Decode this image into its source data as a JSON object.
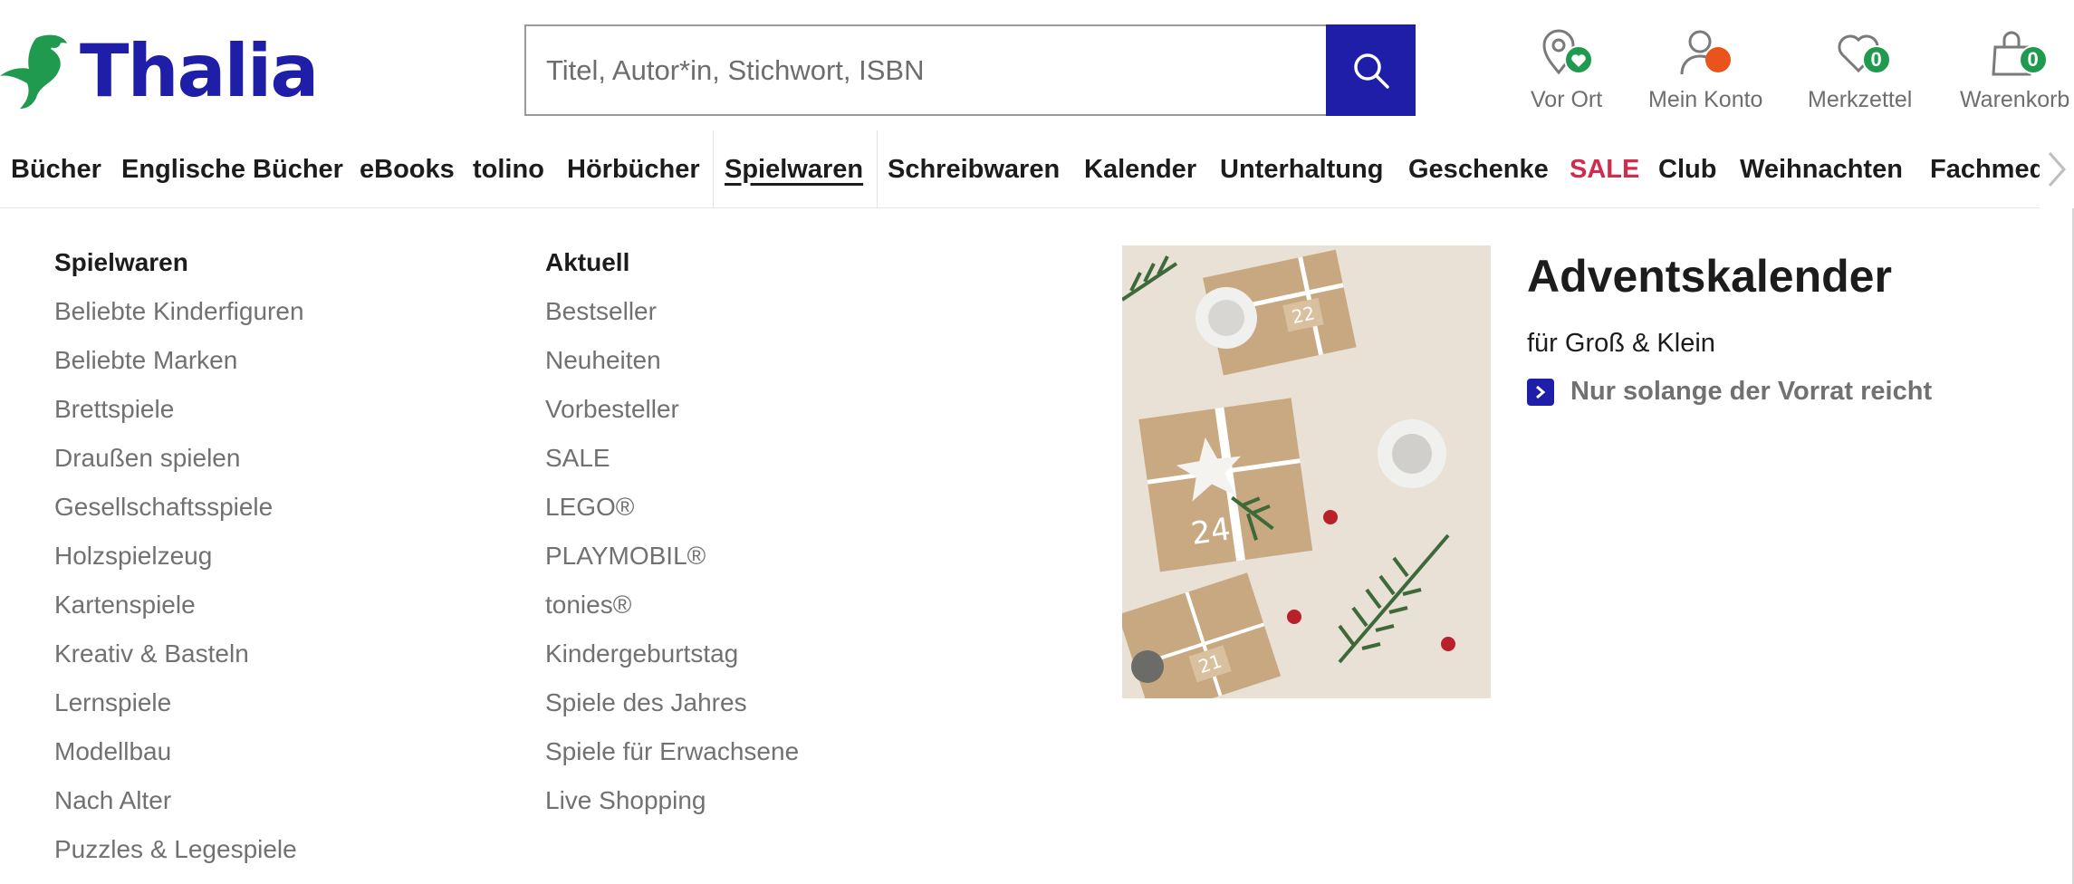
{
  "brand": {
    "name": "Thalia",
    "color": "#1e1ea8",
    "accent": "#1f9a4f"
  },
  "search": {
    "placeholder": "Titel, Autor*in, Stichwort, ISBN",
    "icon": "search-icon"
  },
  "header_items": {
    "store": {
      "label": "Vor Ort",
      "icon": "location-heart-icon"
    },
    "account": {
      "label": "Mein Konto",
      "icon": "user-icon",
      "status_color": "#e8541c"
    },
    "wishlist": {
      "label": "Merkzettel",
      "icon": "heart-icon",
      "count": "0"
    },
    "cart": {
      "label": "Warenkorb",
      "icon": "shopping-bag-icon",
      "count": "0"
    }
  },
  "nav": {
    "items": [
      {
        "label": "Bücher"
      },
      {
        "label": "Englische Bücher"
      },
      {
        "label": "eBooks"
      },
      {
        "label": "tolino"
      },
      {
        "label": "Hörbücher"
      },
      {
        "label": "Spielwaren",
        "active": true
      },
      {
        "label": "Schreibwaren"
      },
      {
        "label": "Kalender"
      },
      {
        "label": "Unterhaltung"
      },
      {
        "label": "Geschenke"
      },
      {
        "label": "SALE",
        "color": "#d12b4e"
      },
      {
        "label": "Club"
      },
      {
        "label": "Weihnachten"
      },
      {
        "label": "Fachmedien"
      }
    ],
    "scroll_icon": "chevron-right-icon"
  },
  "menu": {
    "col1": {
      "title": "Spielwaren",
      "links": [
        "Beliebte Kinderfiguren",
        "Beliebte Marken",
        "Brettspiele",
        "Draußen spielen",
        "Gesellschaftsspiele",
        "Holzspielzeug",
        "Kartenspiele",
        "Kreativ & Basteln",
        "Lernspiele",
        "Modellbau",
        "Nach Alter",
        "Puzzles & Legespiele"
      ]
    },
    "col2": {
      "title": "Aktuell",
      "links": [
        "Bestseller",
        "Neuheiten",
        "Vorbesteller",
        "SALE",
        "LEGO®",
        "PLAYMOBIL®",
        "tonies®",
        "Kindergeburtstag",
        "Spiele des Jahres",
        "Spiele für Erwachsene",
        "Live Shopping"
      ]
    },
    "promo": {
      "title": "Adventskalender",
      "subtitle": "für Groß & Klein",
      "link": "Nur solange der Vorrat reicht",
      "image_numbers": [
        "22",
        "24",
        "21"
      ]
    }
  }
}
